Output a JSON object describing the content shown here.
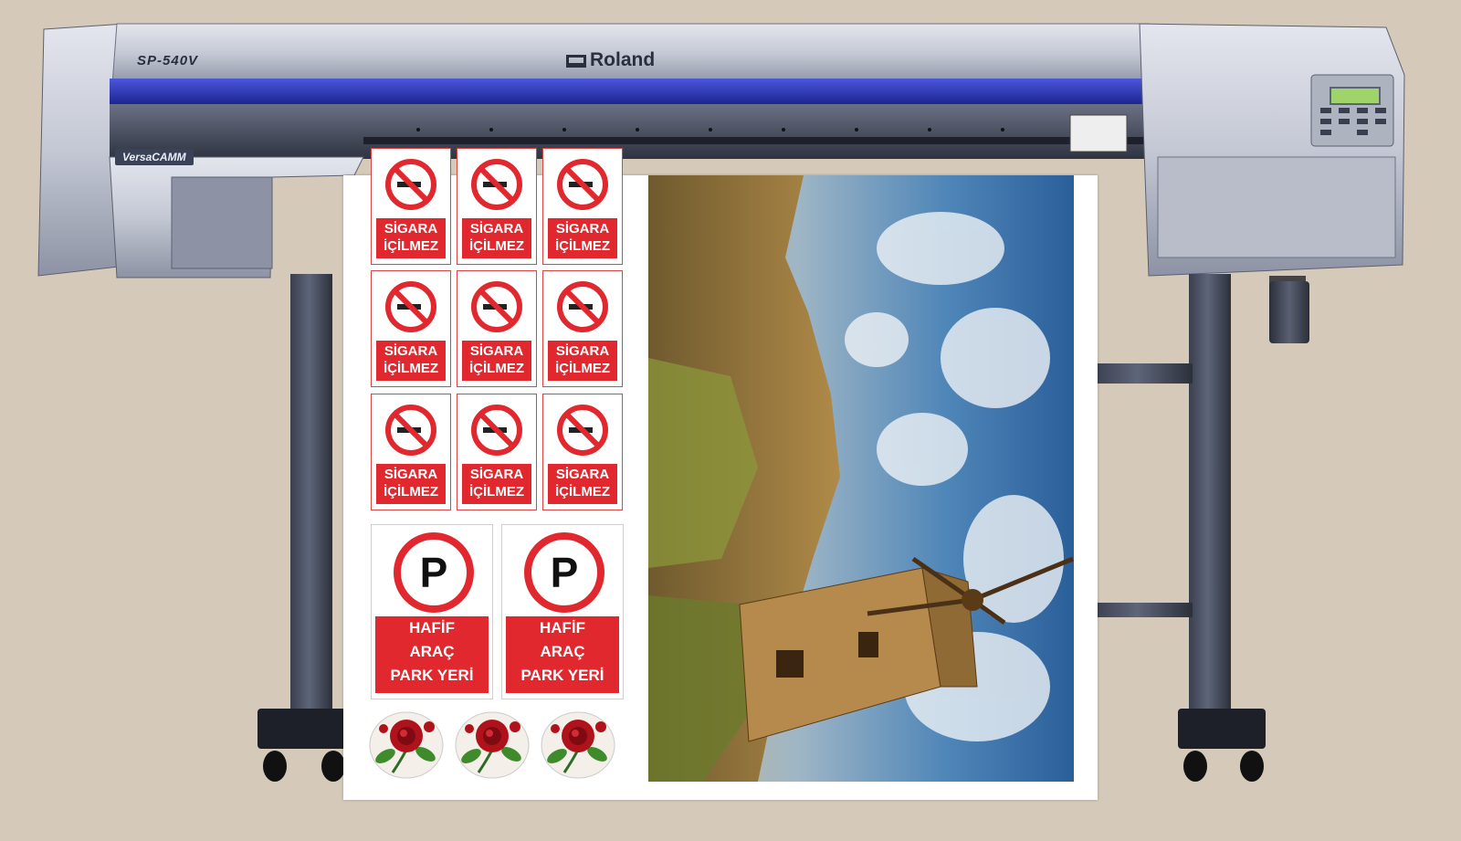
{
  "printer": {
    "model": "SP-540V",
    "brand": "Roland",
    "series": "VersaCAMM"
  },
  "colors": {
    "background": "#d5cab9",
    "printer_body": "#c9ccd6",
    "accent_band": "#2a35b8",
    "sign_red": "#e0282e"
  },
  "print_sheet": {
    "no_smoking_signs": [
      {
        "line1": "SİGARA",
        "line2": "İÇİLMEZ"
      },
      {
        "line1": "SİGARA",
        "line2": "İÇİLMEZ"
      },
      {
        "line1": "SİGARA",
        "line2": "İÇİLMEZ"
      },
      {
        "line1": "SİGARA",
        "line2": "İÇİLMEZ"
      },
      {
        "line1": "SİGARA",
        "line2": "İÇİLMEZ"
      },
      {
        "line1": "SİGARA",
        "line2": "İÇİLMEZ"
      },
      {
        "line1": "SİGARA",
        "line2": "İÇİLMEZ"
      },
      {
        "line1": "SİGARA",
        "line2": "İÇİLMEZ"
      },
      {
        "line1": "SİGARA",
        "line2": "İÇİLMEZ"
      }
    ],
    "parking_signs": [
      {
        "symbol": "P",
        "line1": "HAFİF",
        "line2": "ARAÇ",
        "line3": "PARK YERİ"
      },
      {
        "symbol": "P",
        "line1": "HAFİF",
        "line2": "ARAÇ",
        "line3": "PARK YERİ"
      }
    ],
    "rose_stickers": 3,
    "photo_subject": "windmill-landscape"
  }
}
